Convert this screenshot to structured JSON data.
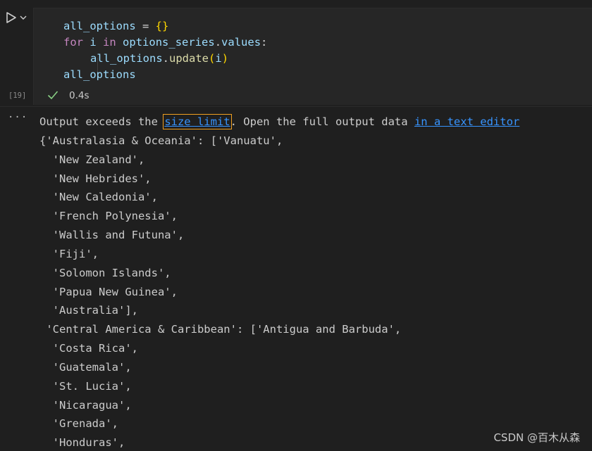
{
  "cell": {
    "execution_count": "[19]",
    "duration": "0.4s",
    "code": {
      "line1": {
        "var": "all_options",
        "op": " = ",
        "brace": "{}"
      },
      "line2": {
        "kw_for": "for",
        "sp1": " ",
        "var_i": "i",
        "sp2": " ",
        "kw_in": "in",
        "sp3": " ",
        "obj": "options_series",
        "dot": ".",
        "attr": "values",
        "colon": ":"
      },
      "line3": {
        "obj": "all_options",
        "dot": ".",
        "func": "update",
        "paren_open": "(",
        "arg": "i",
        "paren_close": ")"
      },
      "line4": {
        "var": "all_options"
      }
    }
  },
  "output": {
    "notice_prefix": "Output exceeds the ",
    "size_limit_link": "size limit",
    "notice_middle": ". Open the full output data ",
    "text_editor_link": "in a text editor",
    "lines": [
      "{'Australasia & Oceania': ['Vanuatu',",
      "  'New Zealand',",
      "  'New Hebrides',",
      "  'New Caledonia',",
      "  'French Polynesia',",
      "  'Wallis and Futuna',",
      "  'Fiji',",
      "  'Solomon Islands',",
      "  'Papua New Guinea',",
      "  'Australia'],",
      " 'Central America & Caribbean': ['Antigua and Barbuda',",
      "  'Costa Rica',",
      "  'Guatemala',",
      "  'St. Lucia',",
      "  'Nicaragua',",
      "  'Grenada',",
      "  'Honduras',"
    ]
  },
  "watermark": "CSDN @百木从森",
  "colors": {
    "background": "#1f1f1f",
    "cell_background": "#262626",
    "link": "#3794ff",
    "success_check": "#89d185",
    "focus_outline": "#f0a020"
  },
  "icons": {
    "run": "play-icon",
    "run_menu": "chevron-down-icon",
    "status": "check-icon",
    "output_actions": "more-icon"
  }
}
